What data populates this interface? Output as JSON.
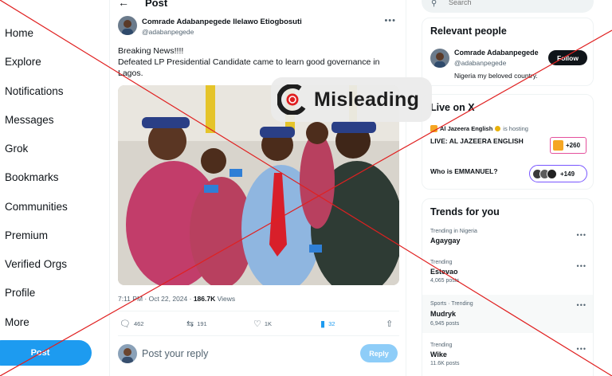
{
  "nav": {
    "items": [
      "Home",
      "Explore",
      "Notifications",
      "Messages",
      "Grok",
      "Bookmarks",
      "Communities",
      "Premium",
      "Verified Orgs",
      "Profile",
      "More"
    ],
    "post_label": "Post"
  },
  "header": {
    "title": "Post"
  },
  "tweet": {
    "author_name": "Comrade Adabanpegede Ilelawo Etiogbosuti",
    "author_handle": "@adabanpegede",
    "text_line1": "Breaking News!!!!",
    "text_line2": "Defeated LP Presidential Candidate came to learn good governance in Lagos.",
    "time": "7:11 PM · Oct 22, 2024 · ",
    "views_count": "186.7K",
    "views_label": " Views",
    "replies": "462",
    "reposts": "191",
    "likes": "1K",
    "bookmarks": "32"
  },
  "reply": {
    "placeholder": "Post your reply",
    "button_label": "Reply"
  },
  "search": {
    "placeholder": "Search"
  },
  "relevant": {
    "title": "Relevant people",
    "name": "Comrade Adabanpegede",
    "handle": "@adabanpegede",
    "bio": "Nigeria my beloved country.",
    "follow_label": "Follow"
  },
  "live": {
    "title": "Live on X",
    "host_name": "Al Jazeera English",
    "host_suffix": "is hosting",
    "space_title": "LIVE: AL JAZEERA ENGLISH",
    "space_count": "+260",
    "space2_title": "Who is EMMANUEL?",
    "space2_count": "+149"
  },
  "trends": {
    "title": "Trends for you",
    "items": [
      {
        "context": "Trending in Nigeria",
        "name": "Agaygay",
        "count": ""
      },
      {
        "context": "Trending",
        "name": "Estevao",
        "count": "4,065 posts"
      },
      {
        "context": "Sports · Trending",
        "name": "Mudryk",
        "count": "6,945 posts"
      },
      {
        "context": "Trending",
        "name": "Wike",
        "count": "11.6K posts"
      }
    ]
  },
  "watermark": {
    "label": "Misleading",
    "color": "#e02020"
  },
  "colors": {
    "accent": "#1d9bf0",
    "text": "#0f1419",
    "muted": "#536471"
  }
}
